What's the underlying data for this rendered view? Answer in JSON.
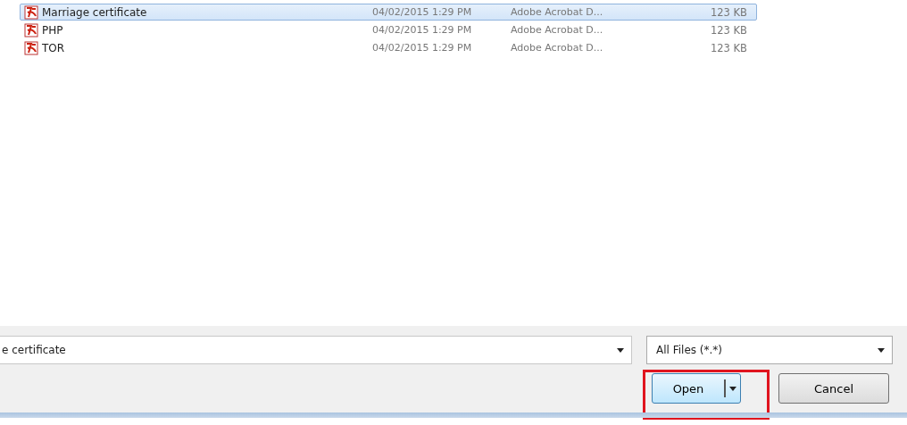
{
  "files": [
    {
      "name": "Marriage certificate",
      "date": "04/02/2015 1:29 PM",
      "type": "Adobe Acrobat D...",
      "size": "123 KB",
      "selected": true
    },
    {
      "name": "PHP",
      "date": "04/02/2015 1:29 PM",
      "type": "Adobe Acrobat D...",
      "size": "123 KB",
      "selected": false
    },
    {
      "name": "TOR",
      "date": "04/02/2015 1:29 PM",
      "type": "Adobe Acrobat D...",
      "size": "123 KB",
      "selected": false
    }
  ],
  "filename": {
    "value": "e certificate"
  },
  "filter": {
    "value": "All Files (*.*)"
  },
  "buttons": {
    "open": {
      "label": "Open",
      "highlighted": true
    },
    "cancel": {
      "label": "Cancel"
    }
  }
}
